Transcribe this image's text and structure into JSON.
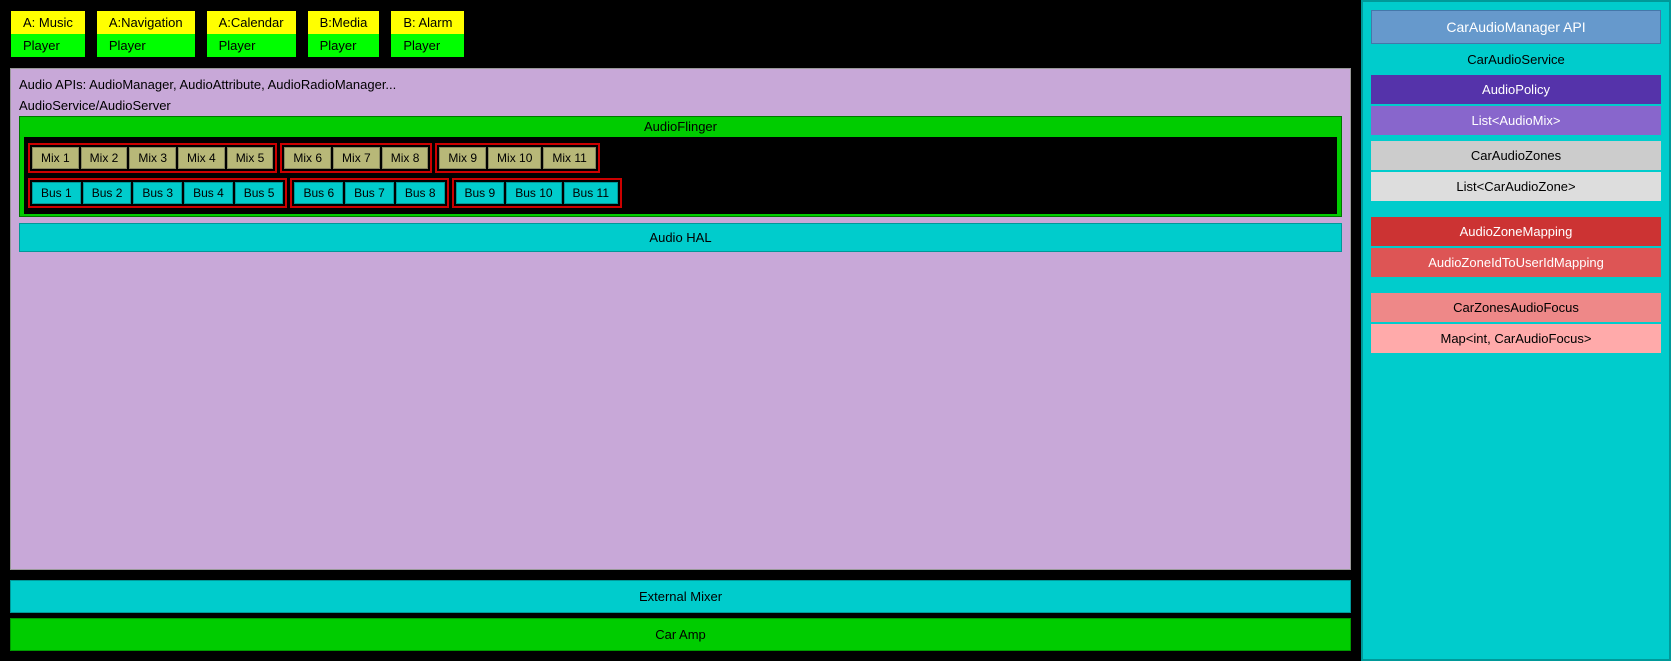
{
  "apps": [
    {
      "id": "a-music",
      "top": "A: Music",
      "bottom": "Player"
    },
    {
      "id": "a-navigation",
      "top": "A:Navigation",
      "bottom": "Player"
    },
    {
      "id": "a-calendar",
      "top": "A:Calendar",
      "bottom": "Player"
    },
    {
      "id": "b-media",
      "top": "B:Media",
      "bottom": "Player"
    },
    {
      "id": "b-alarm",
      "top": "B: Alarm",
      "bottom": "Player"
    }
  ],
  "audio_apis_label": "Audio APIs: AudioManager, AudioAttribute, AudioRadioManager...",
  "audio_service_label": "AudioService/AudioServer",
  "audioflinger_label": "AudioFlinger",
  "mixes": [
    "Mix 1",
    "Mix 2",
    "Mix 3",
    "Mix 4",
    "Mix 5",
    "Mix 6",
    "Mix 7",
    "Mix 8",
    "Mix 9",
    "Mix 10",
    "Mix 11"
  ],
  "buses": [
    "Bus 1",
    "Bus 2",
    "Bus 3",
    "Bus 4",
    "Bus 5",
    "Bus 6",
    "Bus 7",
    "Bus 8",
    "Bus 9",
    "Bus 10",
    "Bus 11"
  ],
  "audio_hal_label": "Audio HAL",
  "external_mixer_label": "External Mixer",
  "car_amp_label": "Car Amp",
  "right_panel": {
    "api_label": "CarAudioManager API",
    "service_label": "CarAudioService",
    "audio_policy_label": "AudioPolicy",
    "list_audio_mix_label": "List<AudioMix>",
    "car_audio_zones_label": "CarAudioZones",
    "list_car_audio_zone_label": "List<CarAudioZone>",
    "audio_zone_mapping_label": "AudioZoneMapping",
    "audio_zone_id_mapping_label": "AudioZoneIdToUserIdMapping",
    "car_zones_audio_focus_label": "CarZonesAudioFocus",
    "map_car_audio_focus_label": "Map<int, CarAudioFocus>"
  }
}
